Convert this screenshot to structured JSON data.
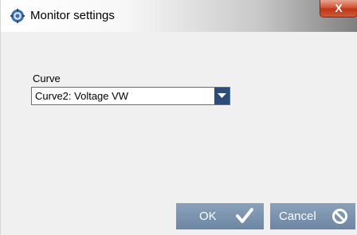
{
  "window": {
    "title": "Monitor settings",
    "app_icon": "gear-monitor-icon",
    "close_label": "X"
  },
  "form": {
    "curve_label": "Curve",
    "curve_value": "Curve2: Voltage VW",
    "dropdown_icon": "chevron-down-icon"
  },
  "buttons": {
    "ok_label": "OK",
    "ok_icon": "checkmark-icon",
    "cancel_label": "Cancel",
    "cancel_icon": "prohibit-icon"
  },
  "colors": {
    "button_bg": "#7b93ae",
    "dropdown_arrow_bg": "#2d4d76",
    "close_red": "#c9452a"
  }
}
